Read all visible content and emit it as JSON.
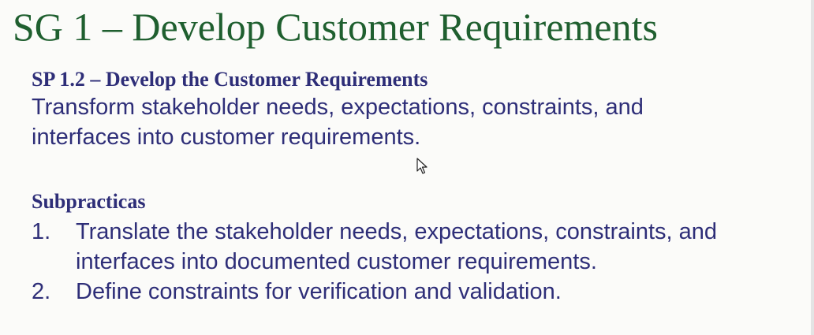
{
  "slide": {
    "title": "SG 1 – Develop Customer Requirements",
    "sp_heading": "SP 1.2 – Develop the Customer Requirements",
    "sp_description": "Transform stakeholder needs, expectations, constraints, and interfaces into customer requirements.",
    "subpractices_heading": "Subpracticas",
    "subpractices": [
      {
        "number": "1.",
        "text": "Translate the stakeholder needs, expectations, constraints, and interfaces into documented customer requirements."
      },
      {
        "number": "2.",
        "text": "Define constraints for verification and validation."
      }
    ]
  },
  "colors": {
    "title": "#1f5f2f",
    "body": "#2e2e78",
    "background": "#fbfbf9"
  },
  "icons": {
    "cursor": "mouse-pointer-icon"
  }
}
